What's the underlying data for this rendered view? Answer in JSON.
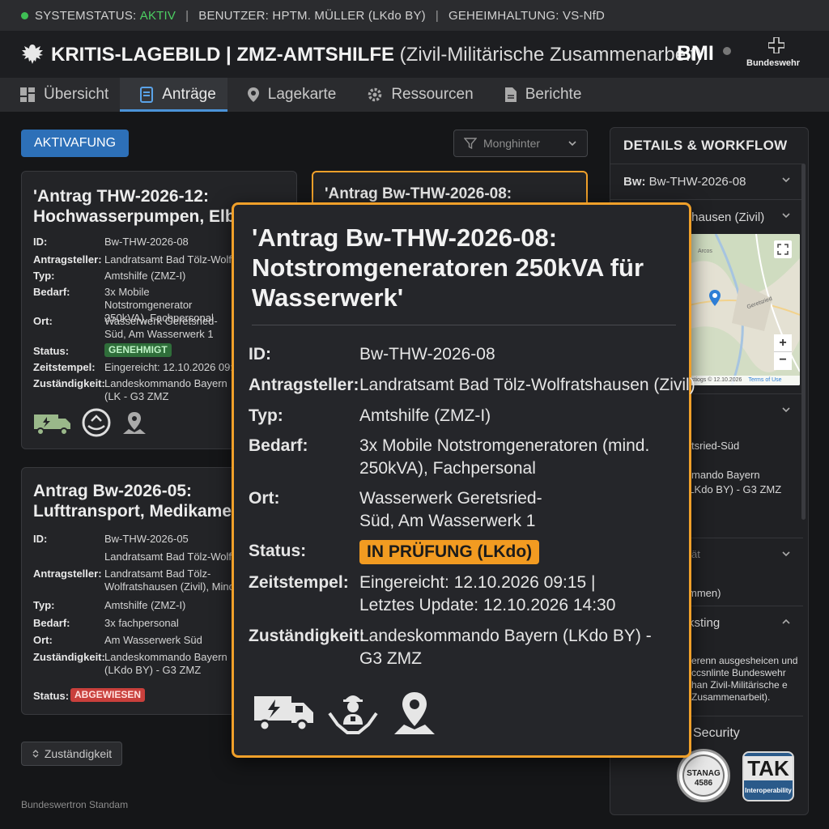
{
  "statusbar": {
    "system_label": "SYSTEMSTATUS:",
    "system_value": "AKTIV",
    "user": "BENUTZER: HPTM. MÜLLER (LKdo BY)",
    "classification": "GEHEIMHALTUNG: VS-NfD"
  },
  "header": {
    "title": "KRITIS-LAGEBILD | ZMZ-AMTSHILFE",
    "subtitle": "(Zivil-Militärische Zusammenarbeit)",
    "bmi": "BMI",
    "bundeswehr": "Bundeswehr"
  },
  "tabs": [
    {
      "label": "Übersicht",
      "icon": "dashboard-icon"
    },
    {
      "label": "Anträge",
      "icon": "document-icon"
    },
    {
      "label": "Lagekarte",
      "icon": "map-pin-icon"
    },
    {
      "label": "Ressourcen",
      "icon": "gear-icon"
    },
    {
      "label": "Berichte",
      "icon": "report-icon"
    }
  ],
  "toolbar": {
    "action_label": "AKTIVAFUNG",
    "filter_placeholder": "Monghinter"
  },
  "cards": {
    "card1": {
      "title_line1": "'Antrag THW-2026-12:",
      "title_line2": "Hochwasserpumpen, Elbe",
      "rows": [
        {
          "k": "ID:",
          "v": "Bw-THW-2026-08"
        },
        {
          "k": "Antragsteller:",
          "v": "Landratsamt Bad Tölz-Wolfrat"
        },
        {
          "k": "Typ:",
          "v": "Amtshilfe (ZMZ-I)"
        },
        {
          "k": "Bedarf:",
          "v": "3x Mobile Notstromgenerator 250kVA), Fachpersonal"
        },
        {
          "k": "Ort:",
          "v": "Wasserwerk Geretsried-Süd, Am Wasserwerk 1"
        },
        {
          "k": "Status:",
          "v": "GENEHMIGT"
        },
        {
          "k": "Zeitstempel:",
          "v": "Eingereicht: 12.10.2026 09:"
        },
        {
          "k": "Zuständigkeit:",
          "v": "Landeskommando Bayern (LK - G3 ZMZ"
        }
      ]
    },
    "card2": {
      "title_line1": "Antrag Bw-2026-05:",
      "title_line2": "Lufttransport, Medikamen",
      "rows": [
        {
          "k": "ID:",
          "v": "Bw-THW-2026-05"
        },
        {
          "k": "",
          "v": "Landratsamt Bad Tölz-Wolfra"
        },
        {
          "k": "Antragsteller:",
          "v": "Landratsamt Bad Tölz-Wolfratshausen (Zivil), Mind."
        },
        {
          "k": "Typ:",
          "v": "Amtshilfe (ZMZ-I)"
        },
        {
          "k": "Bedarf:",
          "v": "3x fachpersonal"
        },
        {
          "k": "Ort:",
          "v": "Am Wasserwerk Süd"
        },
        {
          "k": "Zuständigkeit:",
          "v": "Landeskommando Bayern (LKdo BY) - G3 ZMZ"
        },
        {
          "k": "Status:",
          "v": "ABGEWIESEN"
        }
      ]
    },
    "card3_title": "'Antrag Bw-THW-2026-08:"
  },
  "detail": {
    "title": "'Antrag Bw-THW-2026-08: Notstromgeneratoren 250kVA für Wasserwerk'",
    "rows": [
      {
        "k": "ID:",
        "v": "Bw-THW-2026-08"
      },
      {
        "k": "Antragsteller:",
        "v": "Landratsamt Bad Tölz-Wolfratshausen (Zivil)"
      },
      {
        "k": "Typ:",
        "v": "Amtshilfe (ZMZ-I)"
      },
      {
        "k": "Bedarf:",
        "v": "3x Mobile Notstromgeneratoren (mind. 250kVA), Fachpersonal"
      },
      {
        "k": "Ort:",
        "v": "Wasserwerk Geretsried-Süd, Am Wasserwerk 1"
      },
      {
        "k": "Status:",
        "v": "IN PRÜFUNG (LKdo)"
      },
      {
        "k": "Zeitstempel:",
        "v": "Eingereicht: 12.10.2026 09:15 | Letztes Update: 12.10.2026 14:30"
      },
      {
        "k": "Zuständigkeit:",
        "v": "Landeskommando Bayern (LKdo BY) - G3 ZMZ"
      }
    ]
  },
  "sidebar": {
    "heading": "DETAILS & WORKFLOW",
    "acc1_prefix": "Bw:",
    "acc1_value": "Bw-THW-2026-08",
    "acc2": "thausen (Zivil)",
    "map_town": "Geretsried",
    "map_label": "Arcos",
    "map_attr": "stiogs © 12.10.2026",
    "map_terms": "Terms of Use",
    "text_a": "tsried-Süd",
    "text_b": "mando Bayern",
    "text_c": "(LKdo BY) - G3 ZMZ",
    "acc4": "ät",
    "text_d": "mmen)",
    "acc5": "ksting",
    "paragraph": "erenn ausgesheicen und ccsnlinte Bundeswehr han Zivil-Militärische e Zusammenarbeit).",
    "security": "Security",
    "stanag": "STANAG 4586",
    "tak": "TAK",
    "tak_sub": "Interoperability"
  },
  "bottom": {
    "zust_label": "Zuständigkeit",
    "footer": "Bundeswertron Standam"
  },
  "colors": {
    "accent": "#2d70b8",
    "highlight": "#f0a02a",
    "ok": "#2f6e3a",
    "error": "#c9403c"
  }
}
